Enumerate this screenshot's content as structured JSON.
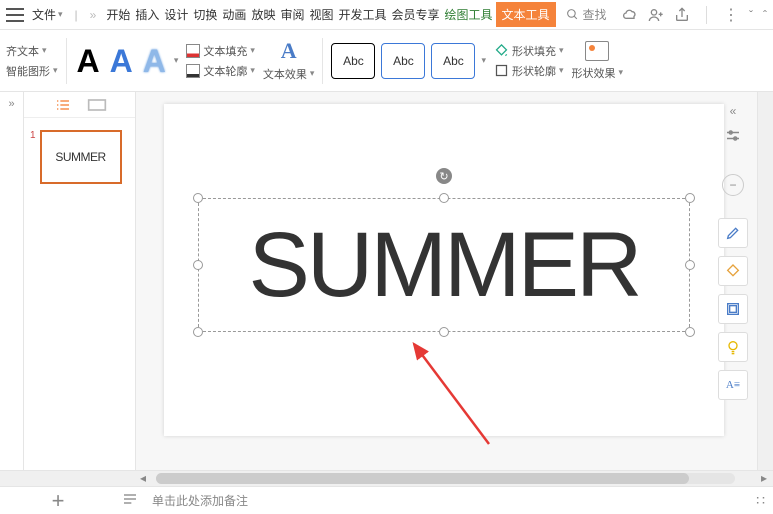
{
  "menubar": {
    "file_label": "文件",
    "tabs": [
      "开始",
      "插入",
      "设计",
      "切换",
      "动画",
      "放映",
      "审阅",
      "视图",
      "开发工具",
      "会员专享"
    ],
    "tool_tab_draw": "绘图工具",
    "tool_tab_text": "文本工具",
    "search_placeholder": "查找"
  },
  "ribbon": {
    "align_text": "齐文本",
    "smart_graphic": "智能图形",
    "text_fill": "文本填充",
    "text_outline": "文本轮廓",
    "text_effect": "文本效果",
    "shape_style_label": "Abc",
    "shape_fill": "形状填充",
    "shape_outline": "形状轮廓",
    "shape_effect": "形状效果"
  },
  "slide": {
    "number": "1",
    "thumb_text": "SUMMER",
    "text_content": "SUMMER"
  },
  "notes": {
    "placeholder": "单击此处添加备注"
  }
}
